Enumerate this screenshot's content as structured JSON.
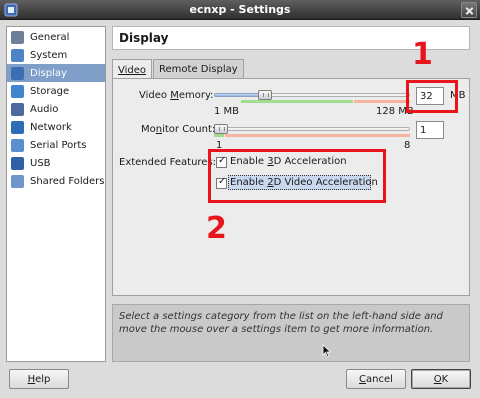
{
  "window": {
    "title": "ecnxp - Settings"
  },
  "sidebar": {
    "items": [
      {
        "label": "General",
        "icon": "general-icon",
        "color": "#6e7f9a"
      },
      {
        "label": "System",
        "icon": "system-icon",
        "color": "#4f83c6"
      },
      {
        "label": "Display",
        "icon": "display-icon",
        "color": "#3b6fb3",
        "selected": true
      },
      {
        "label": "Storage",
        "icon": "storage-icon",
        "color": "#3f86cf"
      },
      {
        "label": "Audio",
        "icon": "audio-icon",
        "color": "#4a6aa0"
      },
      {
        "label": "Network",
        "icon": "network-icon",
        "color": "#2e6cb8"
      },
      {
        "label": "Serial Ports",
        "icon": "serial-ports-icon",
        "color": "#5a8fd0"
      },
      {
        "label": "USB",
        "icon": "usb-icon",
        "color": "#2f5fa5"
      },
      {
        "label": "Shared Folders",
        "icon": "folder-icon",
        "color": "#6f95cc"
      }
    ]
  },
  "main": {
    "section_title": "Display",
    "tabs": [
      {
        "label": "Video",
        "active": true
      },
      {
        "label": "Remote Display",
        "active": false
      }
    ],
    "video_memory": {
      "label_pre": "Video ",
      "label_accel": "M",
      "label_post": "emory:",
      "value": "32",
      "unit": "MB",
      "min_label": "1 MB",
      "max_label": "128 MB",
      "level_fraction": 0.24
    },
    "monitor_count": {
      "label_pre": "Mo",
      "label_accel": "n",
      "label_post": "itor Count:",
      "value": "1",
      "min_label": "1",
      "max_label": "8",
      "level_fraction": 0.0
    },
    "extended_features": {
      "label": "Extended Features:",
      "accel_3d": {
        "pre": "Enable ",
        "accel": "3",
        "post": "D Acceleration",
        "checked": true
      },
      "accel_2d": {
        "pre": "Enable ",
        "accel": "2",
        "post": "D Video Acceleration",
        "checked": true
      }
    },
    "annotations": {
      "one": "1",
      "two": "2",
      "color": "#e8141b"
    }
  },
  "info_text": "Select a settings category from the list on the left-hand side and move the mouse over a settings item to get more information.",
  "buttons": {
    "help": {
      "accel": "H",
      "rest": "elp"
    },
    "cancel": {
      "accel": "C",
      "rest": "ancel"
    },
    "ok": {
      "accel": "O",
      "rest": "K"
    }
  }
}
